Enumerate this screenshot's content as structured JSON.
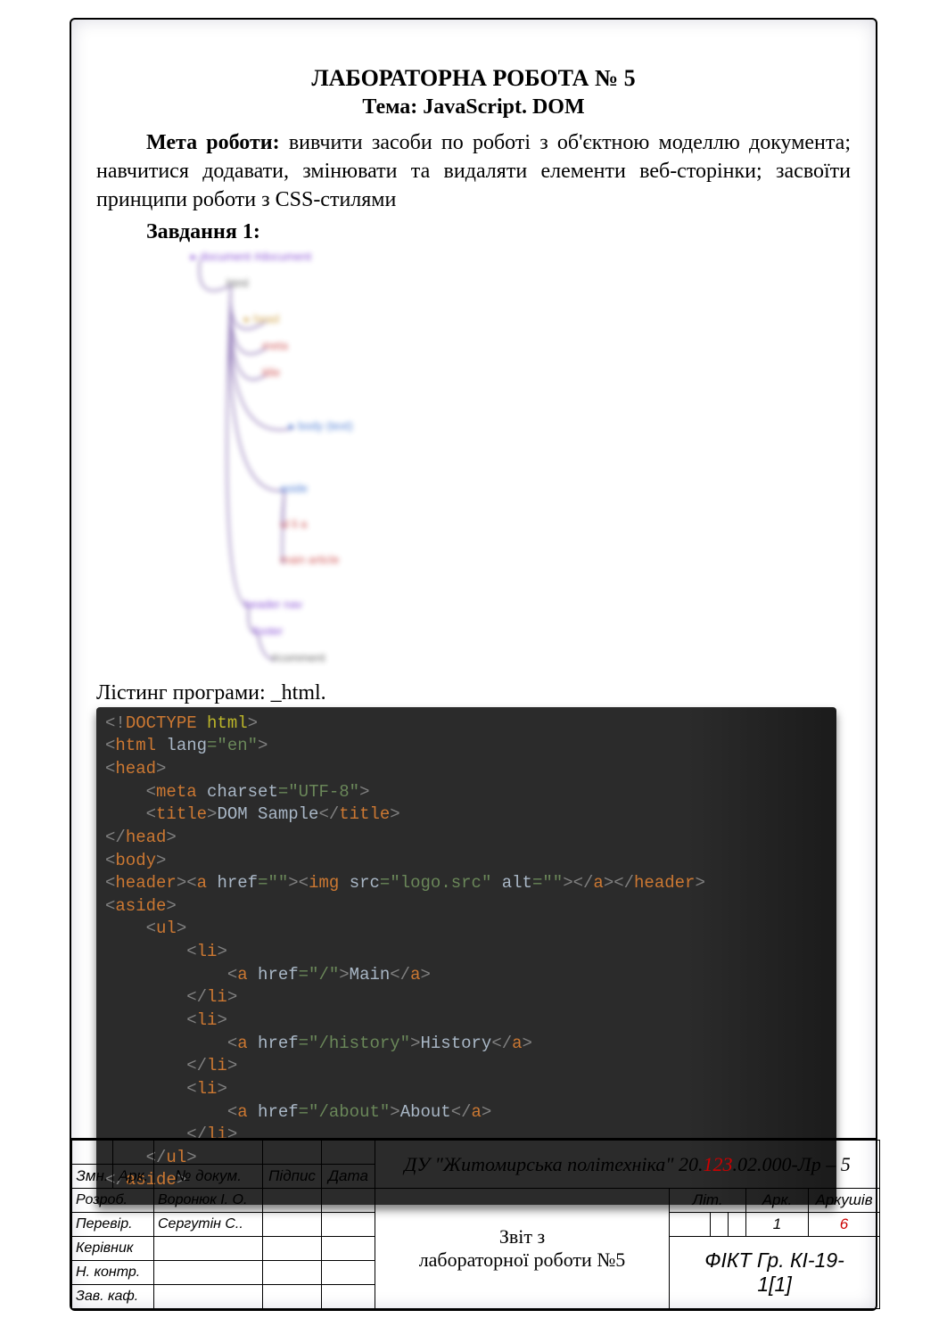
{
  "header": {
    "title": "ЛАБОРАТОРНА РОБОТА № 5",
    "topic_prefix": "Тема:",
    "topic": "JavaScript. DOM"
  },
  "goal": {
    "label": "Мета роботи:",
    "text": " вивчити засоби по роботі з об'єктною моделлю документа; навчитися додавати, змінювати та видаляти елементи веб-сторінки; засвоїти принципи роботи з CSS-стилями"
  },
  "task": {
    "label": "Завдання 1:"
  },
  "listing": {
    "label": "Лістинг програми:  _html."
  },
  "diagram_nodes": {
    "n1": "▸ document  #document",
    "n2": "html",
    "n3": "▸ head",
    "n4": "meta",
    "n5": "title",
    "n6": "▸ body  (text)",
    "n7": "aside",
    "n8": "ul  li  a",
    "n9": "main  article",
    "n10": "header  nav",
    "n11": "footer",
    "n12": "#comment"
  },
  "code_lines": [
    {
      "html": "<span class='gr'>&lt;!</span><span class='k'>DOCTYPE </span><span class='yl'>html</span><span class='gr'>&gt;</span>"
    },
    {
      "html": "<span class='gr'>&lt;</span><span class='k'>html </span><span class='wh'>lang</span><span class='grn'>=\"en\"</span><span class='gr'>&gt;</span>"
    },
    {
      "html": "<span class='gr'>&lt;</span><span class='k'>head</span><span class='gr'>&gt;</span>"
    },
    {
      "html": "    <span class='gr'>&lt;</span><span class='k'>meta </span><span class='wh'>charset</span><span class='grn'>=\"UTF-8\"</span><span class='gr'>&gt;</span>"
    },
    {
      "html": "    <span class='gr'>&lt;</span><span class='k'>title</span><span class='gr'>&gt;</span><span class='wh'>DOM Sample</span><span class='gr'>&lt;/</span><span class='k'>title</span><span class='gr'>&gt;</span>"
    },
    {
      "html": "<span class='gr'>&lt;/</span><span class='k'>head</span><span class='gr'>&gt;</span>"
    },
    {
      "html": "<span class='gr'>&lt;</span><span class='k'>body</span><span class='gr'>&gt;</span>"
    },
    {
      "html": "<span class='gr'>&lt;</span><span class='k'>header</span><span class='gr'>&gt;&lt;</span><span class='k'>a </span><span class='wh'>href</span><span class='grn'>=\"\"</span><span class='gr'>&gt;&lt;</span><span class='k'>img </span><span class='wh'>src</span><span class='grn'>=\"logo.src\" </span><span class='wh'>alt</span><span class='grn'>=\"\"</span><span class='gr'>&gt;&lt;/</span><span class='k'>a</span><span class='gr'>&gt;&lt;/</span><span class='k'>header</span><span class='gr'>&gt;</span>"
    },
    {
      "html": "<span class='gr'>&lt;</span><span class='k'>aside</span><span class='gr'>&gt;</span>"
    },
    {
      "html": "    <span class='gr'>&lt;</span><span class='k'>ul</span><span class='gr'>&gt;</span>"
    },
    {
      "html": "        <span class='gr'>&lt;</span><span class='k'>li</span><span class='gr'>&gt;</span>"
    },
    {
      "html": "            <span class='gr'>&lt;</span><span class='k'>a </span><span class='wh'>href</span><span class='grn'>=\"/\"</span><span class='gr'>&gt;</span><span class='wh'>Main</span><span class='gr'>&lt;/</span><span class='k'>a</span><span class='gr'>&gt;</span>"
    },
    {
      "html": "        <span class='gr'>&lt;/</span><span class='k'>li</span><span class='gr'>&gt;</span>"
    },
    {
      "html": "        <span class='gr'>&lt;</span><span class='k'>li</span><span class='gr'>&gt;</span>"
    },
    {
      "html": "            <span class='gr'>&lt;</span><span class='k'>a </span><span class='wh'>href</span><span class='grn'>=\"/history\"</span><span class='gr'>&gt;</span><span class='wh'>History</span><span class='gr'>&lt;/</span><span class='k'>a</span><span class='gr'>&gt;</span>"
    },
    {
      "html": "        <span class='gr'>&lt;/</span><span class='k'>li</span><span class='gr'>&gt;</span>"
    },
    {
      "html": "        <span class='gr'>&lt;</span><span class='k'>li</span><span class='gr'>&gt;</span>"
    },
    {
      "html": "            <span class='gr'>&lt;</span><span class='k'>a </span><span class='wh'>href</span><span class='grn'>=\"/about\"</span><span class='gr'>&gt;</span><span class='wh'>About</span><span class='gr'>&lt;/</span><span class='k'>a</span><span class='gr'>&gt;</span>"
    },
    {
      "html": "        <span class='gr'>&lt;/</span><span class='k'>li</span><span class='gr'>&gt;</span>"
    },
    {
      "html": "    <span class='gr'>&lt;/</span><span class='k'>ul</span><span class='gr'>&gt;</span>"
    },
    {
      "html": "<span class='gr'>&lt;/</span><span class='k'>aside</span><span class='gr'>&gt;</span>"
    }
  ],
  "stamp": {
    "doc_code_prefix": "ДУ \"Житомирська політехніка\" 20.",
    "doc_code_red": "123",
    "doc_code_suffix": ".02.000-Лр – 5",
    "col_zmn": "Змн.",
    "col_ark": "Арк.",
    "col_ndoc": "№ докум.",
    "col_pidp": "Підпис",
    "col_data": "Дата",
    "row_rozrob": "Розроб.",
    "row_rozrob_val": "Воронюк І. О.",
    "row_perevir": "Перевір.",
    "row_perevir_val": "Сергутін С..",
    "row_kerivnyk": "Керівник",
    "row_nkontr": "Н. контр.",
    "row_zavkaf": "Зав. каф.",
    "report_title1": "Звіт з",
    "report_title2": "лабораторної роботи №5",
    "lit": "Літ.",
    "ark": "Арк.",
    "arkushiv": "Аркушів",
    "ark_val": "1",
    "arkushiv_val": "6",
    "group1": "ФІКТ Гр. КІ-19-",
    "group2": "1[1]"
  }
}
